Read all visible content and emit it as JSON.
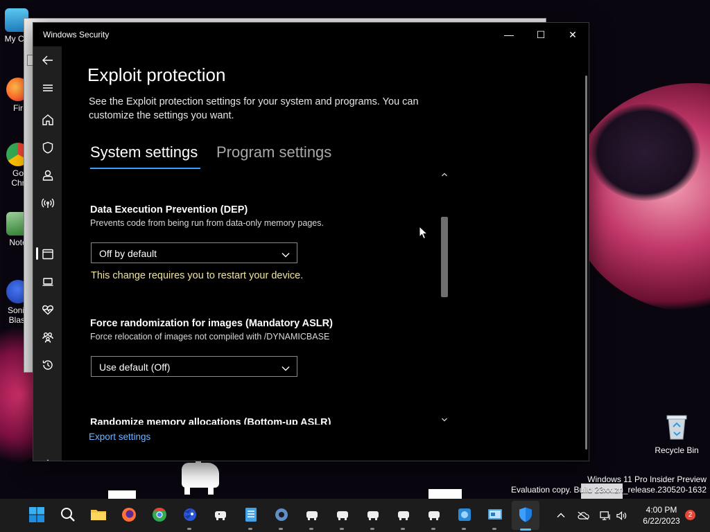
{
  "desktop": {
    "icons": [
      {
        "label": "My Co",
        "name": "this-pc"
      },
      {
        "label": "Fir",
        "name": "firefox"
      },
      {
        "label": "Go Chr",
        "name": "chrome"
      },
      {
        "label": "Note",
        "name": "notepad"
      },
      {
        "label": "Sonic Blast",
        "name": "sonic"
      }
    ],
    "recycle_bin_label": "Recycle Bin",
    "watermark_line1": "Windows 11 Pro Insider Preview",
    "watermark_line2": "Evaluation copy. Build 23xx.zn_release.230520-1632"
  },
  "window": {
    "title": "Windows Security",
    "controls": {
      "minimize": "—",
      "maximize": "☐",
      "close": "✕"
    }
  },
  "nav": {
    "items": [
      {
        "name": "back-arrow-icon"
      },
      {
        "name": "menu-icon"
      },
      {
        "name": "home-icon"
      },
      {
        "name": "shield-icon"
      },
      {
        "name": "person-icon"
      },
      {
        "name": "wifi-antenna-icon"
      },
      {
        "name": "app-browser-icon",
        "selected": true
      },
      {
        "name": "laptop-icon"
      },
      {
        "name": "heart-pulse-icon"
      },
      {
        "name": "family-icon"
      },
      {
        "name": "history-icon"
      },
      {
        "name": "settings-gear-icon"
      }
    ]
  },
  "page": {
    "title": "Exploit protection",
    "description": "See the Exploit protection settings for your system and programs.  You can customize the settings you want.",
    "tabs": [
      {
        "label": "System settings",
        "active": true
      },
      {
        "label": "Program settings",
        "active": false
      }
    ],
    "settings": [
      {
        "title": "Data Execution Prevention (DEP)",
        "description": "Prevents code from being run from data-only memory pages.",
        "value": "Off by default",
        "warning": "This change requires you to restart your device."
      },
      {
        "title": "Force randomization for images (Mandatory ASLR)",
        "description": "Force relocation of images not compiled with /DYNAMICBASE",
        "value": "Use default (Off)"
      },
      {
        "title": "Randomize memory allocations (Bottom-up ASLR)"
      }
    ],
    "export_link": "Export settings"
  },
  "taskbar": {
    "apps": [
      {
        "name": "start-button"
      },
      {
        "name": "search-button"
      },
      {
        "name": "file-explorer"
      },
      {
        "name": "firefox"
      },
      {
        "name": "chrome"
      },
      {
        "name": "sonic-game"
      },
      {
        "name": "game-app-1"
      },
      {
        "name": "notepad"
      },
      {
        "name": "settings"
      },
      {
        "name": "game-app-2"
      },
      {
        "name": "game-app-3"
      },
      {
        "name": "game-app-4"
      },
      {
        "name": "game-app-5"
      },
      {
        "name": "game-app-6"
      },
      {
        "name": "game-app-7"
      },
      {
        "name": "control-panel"
      },
      {
        "name": "windows-security"
      }
    ],
    "time": "4:00 PM",
    "date": "6/22/2023",
    "notification_count": "2"
  }
}
